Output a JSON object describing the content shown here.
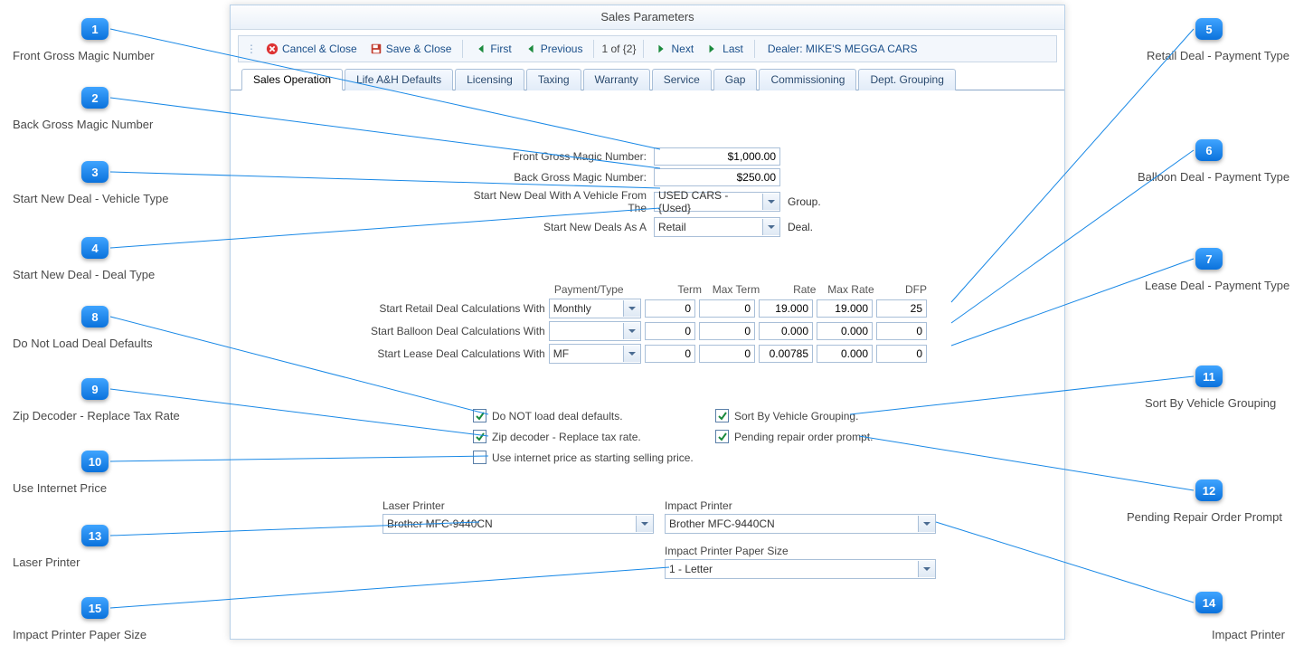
{
  "title": "Sales Parameters",
  "toolbar": {
    "cancel": "Cancel & Close",
    "save": "Save & Close",
    "first": "First",
    "prev": "Previous",
    "page": "1 of {2}",
    "next": "Next",
    "last": "Last",
    "dealer": "Dealer: MIKE'S MEGGA CARS"
  },
  "tabs": [
    "Sales Operation",
    "Life A&H Defaults",
    "Licensing",
    "Taxing",
    "Warranty",
    "Service",
    "Gap",
    "Commissioning",
    "Dept. Grouping"
  ],
  "magic": {
    "front_label": "Front Gross Magic Number:",
    "front_value": "$1,000.00",
    "back_label": "Back Gross Magic Number:",
    "back_value": "$250.00",
    "vehicle_label": "Start New Deal With A Vehicle From The",
    "vehicle_value": "USED CARS - {Used}",
    "vehicle_suffix": "Group.",
    "dealtype_label": "Start New Deals As A",
    "dealtype_value": "Retail",
    "dealtype_suffix": "Deal."
  },
  "calc": {
    "headers": {
      "pt": "Payment/Type",
      "term": "Term",
      "maxterm": "Max Term",
      "rate": "Rate",
      "maxrate": "Max Rate",
      "dfp": "DFP"
    },
    "retail": {
      "label": "Start Retail Deal Calculations With",
      "pt": "Monthly",
      "term": "0",
      "maxterm": "0",
      "rate": "19.000",
      "maxrate": "19.000",
      "dfp": "25"
    },
    "balloon": {
      "label": "Start Balloon Deal Calculations With",
      "pt": "",
      "term": "0",
      "maxterm": "0",
      "rate": "0.000",
      "maxrate": "0.000",
      "dfp": "0"
    },
    "lease": {
      "label": "Start Lease Deal Calculations With",
      "pt": "MF",
      "term": "0",
      "maxterm": "0",
      "rate": "0.00785",
      "maxrate": "0.000",
      "dfp": "0"
    }
  },
  "checks": {
    "noload": {
      "label": "Do NOT load deal defaults.",
      "checked": true
    },
    "zip": {
      "label": "Zip decoder - Replace tax rate.",
      "checked": true
    },
    "internet": {
      "label": "Use internet price as starting selling price.",
      "checked": false
    },
    "sortveh": {
      "label": "Sort By Vehicle Grouping.",
      "checked": true
    },
    "repair": {
      "label": "Pending repair order prompt.",
      "checked": true
    }
  },
  "printers": {
    "laser_label": "Laser Printer",
    "laser_value": "Brother MFC-9440CN",
    "impact_label": "Impact Printer",
    "impact_value": "Brother MFC-9440CN",
    "paper_label": "Impact Printer Paper Size",
    "paper_value": "1 - Letter"
  },
  "callouts": {
    "c1": "Front Gross Magic Number",
    "c2": "Back Gross Magic Number",
    "c3": "Start New Deal - Vehicle Type",
    "c4": "Start New Deal - Deal Type",
    "c5": "Retail Deal - Payment Type",
    "c6": "Balloon Deal - Payment Type",
    "c7": "Lease Deal - Payment Type",
    "c8": "Do Not Load Deal Defaults",
    "c9": "Zip Decoder - Replace Tax Rate",
    "c10": "Use Internet Price",
    "c11": "Sort By Vehicle Grouping",
    "c12": "Pending Repair Order Prompt",
    "c13": "Laser Printer",
    "c14": "Impact Printer",
    "c15": "Impact Printer Paper Size"
  }
}
